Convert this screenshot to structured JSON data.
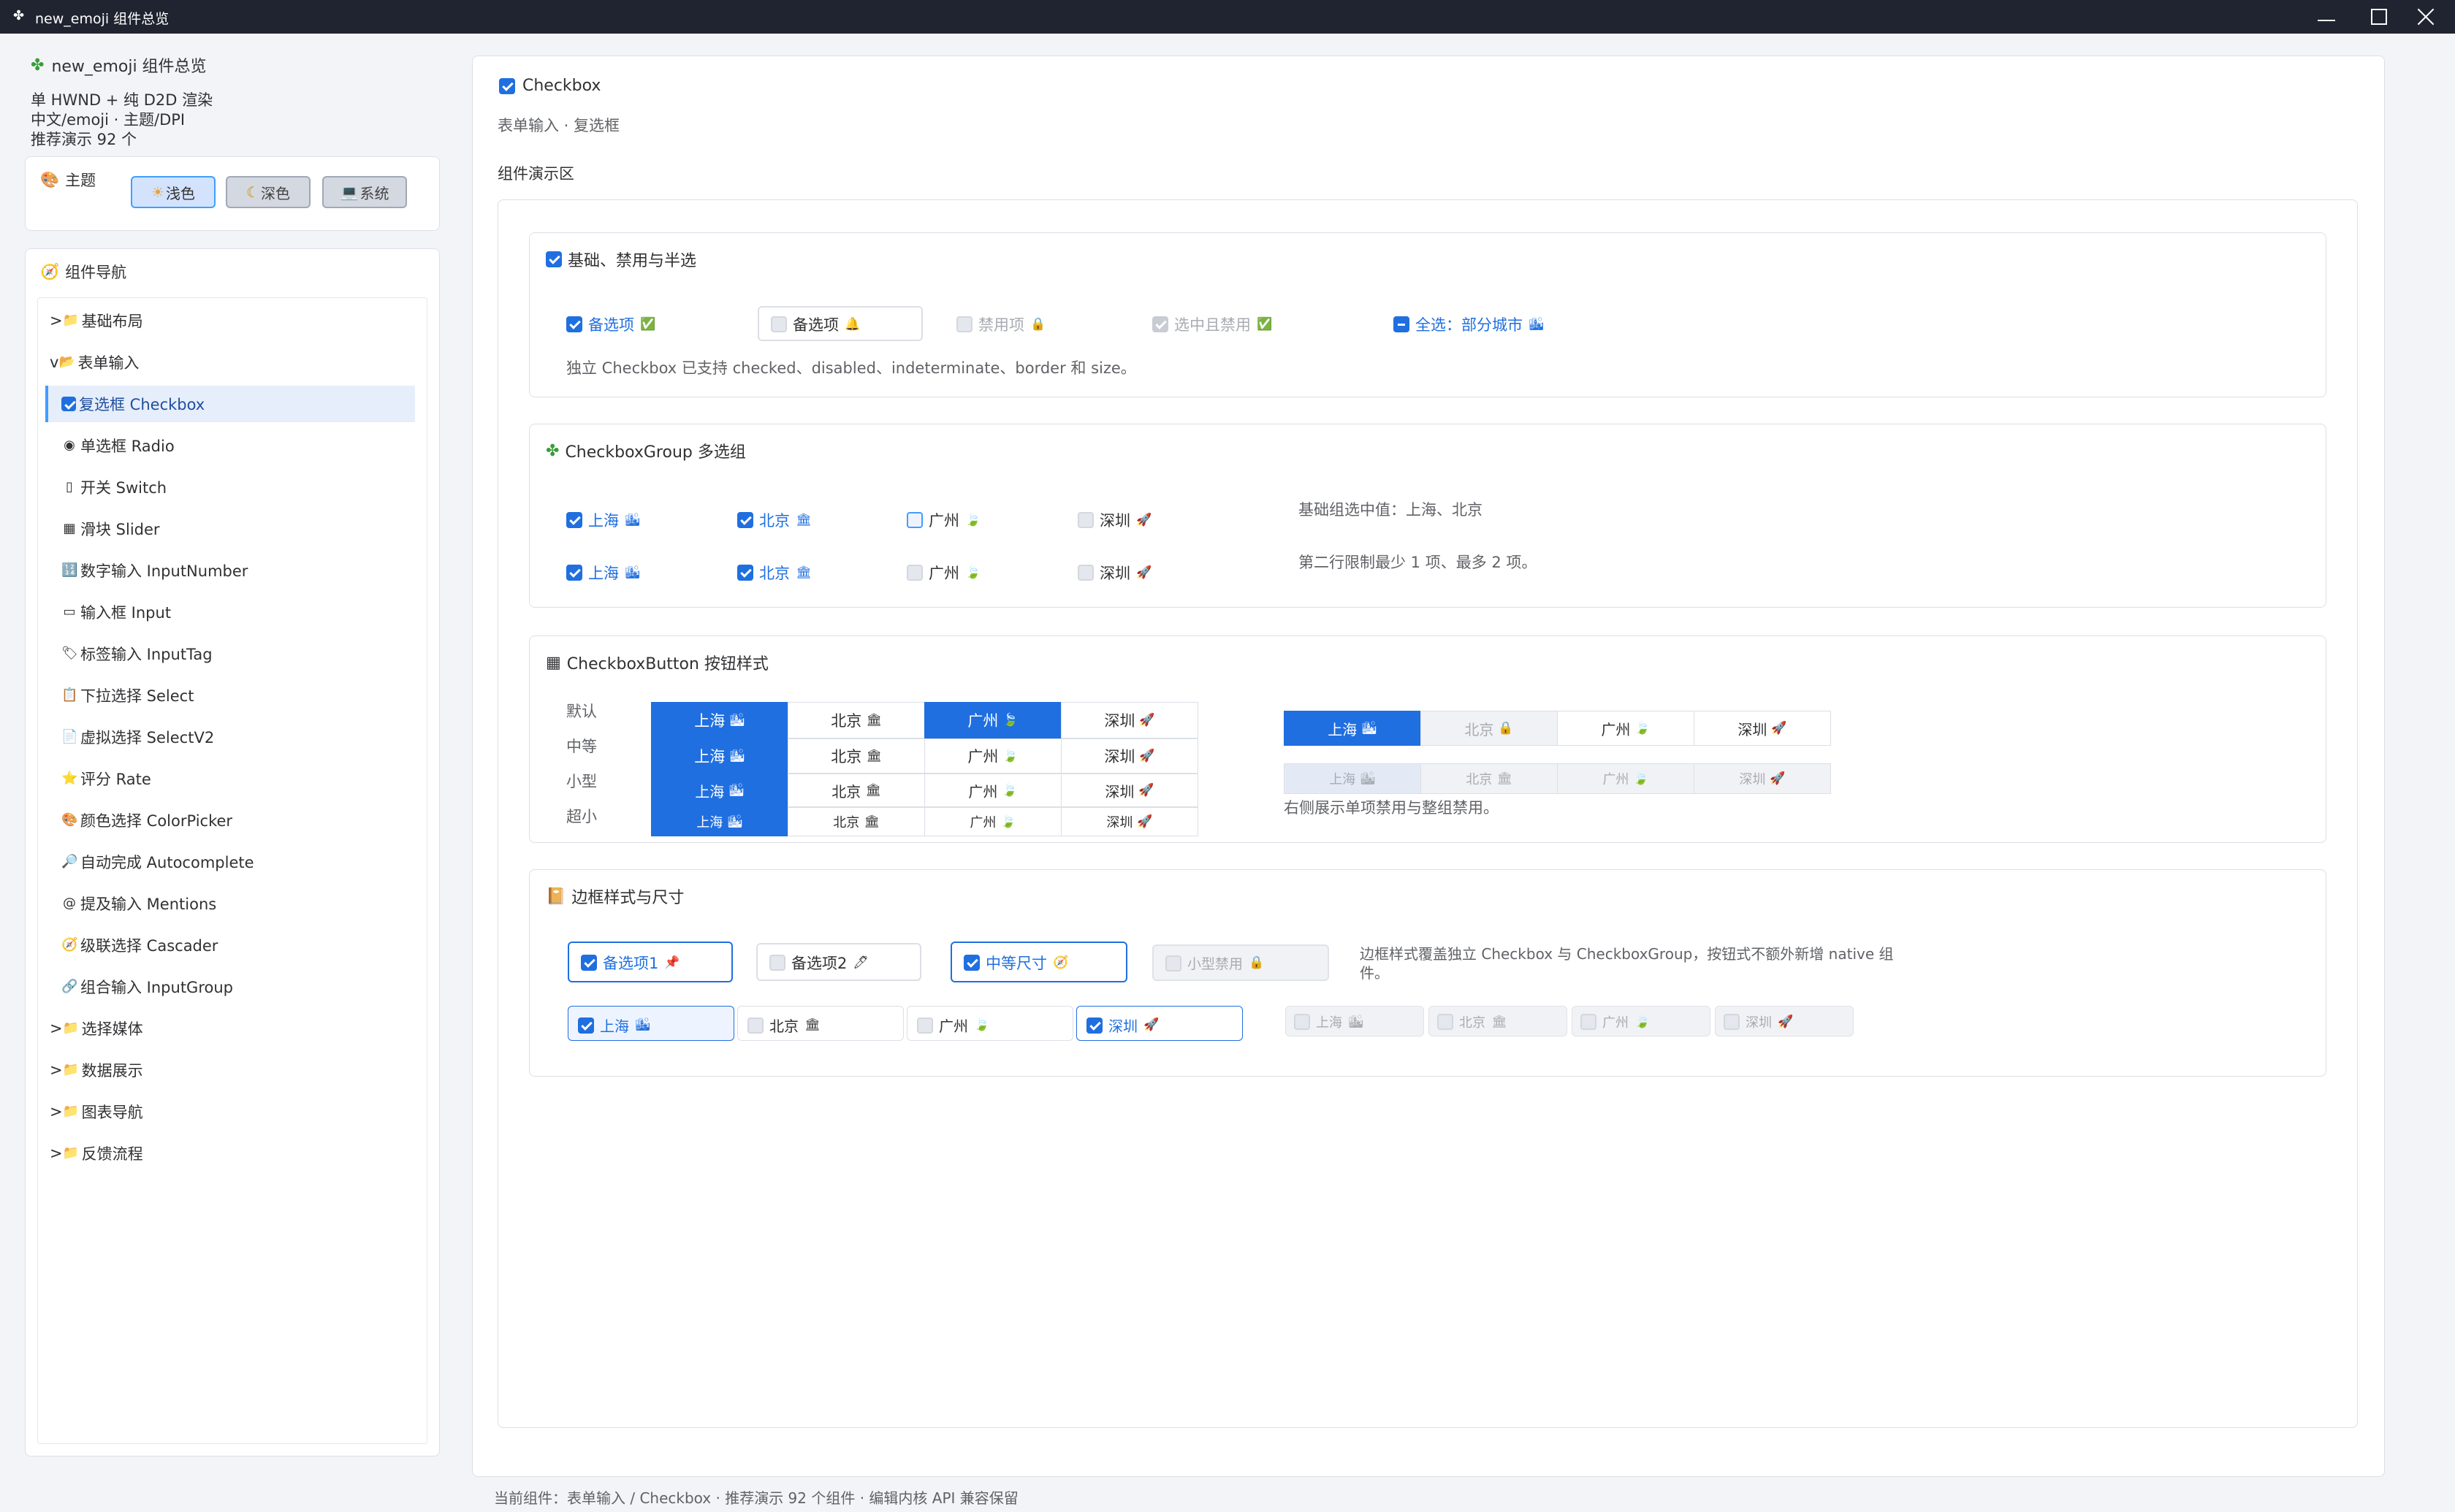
{
  "window": {
    "title": "new_emoji 组件总览",
    "icon": "clover-icon"
  },
  "sidebar": {
    "app_title": "new_emoji 组件总览",
    "info_lines": [
      "单 HWND + 纯 D2D 渲染",
      "中文/emoji · 主题/DPI",
      "推荐演示 92 个"
    ],
    "theme": {
      "label": "主题",
      "buttons": [
        {
          "label": "浅色",
          "icon": "☀",
          "active": true
        },
        {
          "label": "深色",
          "icon": "☾",
          "active": false
        },
        {
          "label": "系统",
          "icon": "💻",
          "active": false
        }
      ]
    },
    "nav": {
      "title": "组件导航",
      "items": [
        {
          "label": "基础布局",
          "prefix": ">",
          "icon": "📁"
        },
        {
          "label": "表单输入",
          "prefix": "v",
          "icon": "📂"
        },
        {
          "label": "复选框 Checkbox",
          "icon": "☑"
        },
        {
          "label": "单选框 Radio",
          "icon": "◉"
        },
        {
          "label": "开关 Switch",
          "icon": "▯"
        },
        {
          "label": "滑块 Slider",
          "icon": "▦"
        },
        {
          "label": "数字输入 InputNumber",
          "icon": "🔢"
        },
        {
          "label": "输入框 Input",
          "icon": "▭"
        },
        {
          "label": "标签输入 InputTag",
          "icon": "🏷"
        },
        {
          "label": "下拉选择 Select",
          "icon": "📋"
        },
        {
          "label": "虚拟选择 SelectV2",
          "icon": "📄"
        },
        {
          "label": "评分 Rate",
          "icon": "⭐"
        },
        {
          "label": "颜色选择 ColorPicker",
          "icon": "🎨"
        },
        {
          "label": "自动完成 Autocomplete",
          "icon": "🔎"
        },
        {
          "label": "提及输入 Mentions",
          "icon": "@"
        },
        {
          "label": "级联选择 Cascader",
          "icon": "🧭"
        },
        {
          "label": "组合输入 InputGroup",
          "icon": "🔗"
        },
        {
          "label": "选择媒体",
          "prefix": ">",
          "icon": "📁"
        },
        {
          "label": "数据展示",
          "prefix": ">",
          "icon": "📁"
        },
        {
          "label": "图表导航",
          "prefix": ">",
          "icon": "📁"
        },
        {
          "label": "反馈流程",
          "prefix": ">",
          "icon": "📁"
        }
      ]
    }
  },
  "main": {
    "title": "Checkbox",
    "subtitle": "表单输入 · 复选框",
    "demo_label": "组件演示区",
    "sec1": {
      "title": "基础、禁用与半选",
      "items": [
        {
          "label": "备选项",
          "emoji": "✅",
          "state": "on"
        },
        {
          "label": "备选项",
          "emoji": "🔔",
          "state": "off"
        },
        {
          "label": "禁用项",
          "emoji": "🔒",
          "state": "dis"
        },
        {
          "label": "选中且禁用",
          "emoji": "✅",
          "state": "dison"
        },
        {
          "label": "全选：部分城市",
          "emoji": "🏙",
          "state": "ind"
        }
      ],
      "note": "独立 Checkbox 已支持 checked、disabled、indeterminate、border 和 size。"
    },
    "sec2": {
      "title": "CheckboxGroup 多选组",
      "row1": [
        {
          "label": "上海",
          "emoji": "🏙",
          "state": "on"
        },
        {
          "label": "北京",
          "emoji": "🏛",
          "state": "on"
        },
        {
          "label": "广州",
          "emoji": "🍃",
          "state": "hl"
        },
        {
          "label": "深圳",
          "emoji": "🚀",
          "state": "dis"
        }
      ],
      "row2": [
        {
          "label": "上海",
          "emoji": "🏙",
          "state": "on"
        },
        {
          "label": "北京",
          "emoji": "🏛",
          "state": "on"
        },
        {
          "label": "广州",
          "emoji": "🍃",
          "state": "dis"
        },
        {
          "label": "深圳",
          "emoji": "🚀",
          "state": "dis"
        }
      ],
      "note1": "基础组选中值：上海、北京",
      "note2": "第二行限制最少 1 项、最多 2 项。"
    },
    "sec3": {
      "title": "CheckboxButton 按钮样式",
      "size_labels": [
        "默认",
        "中等",
        "小型",
        "超小"
      ],
      "rows": [
        [
          {
            "label": "上海",
            "emoji": "🏙",
            "state": "on"
          },
          {
            "label": "北京",
            "emoji": "🏛",
            "state": "off"
          },
          {
            "label": "广州",
            "emoji": "🍃",
            "state": "on"
          },
          {
            "label": "深圳",
            "emoji": "🚀",
            "state": "off"
          }
        ],
        [
          {
            "label": "上海",
            "emoji": "🏙",
            "state": "on"
          },
          {
            "label": "北京",
            "emoji": "🏛",
            "state": "off"
          },
          {
            "label": "广州",
            "emoji": "🍃",
            "state": "off"
          },
          {
            "label": "深圳",
            "emoji": "🚀",
            "state": "off"
          }
        ],
        [
          {
            "label": "上海",
            "emoji": "🏙",
            "state": "on"
          },
          {
            "label": "北京",
            "emoji": "🏛",
            "state": "off"
          },
          {
            "label": "广州",
            "emoji": "🍃",
            "state": "off"
          },
          {
            "label": "深圳",
            "emoji": "🚀",
            "state": "off"
          }
        ],
        [
          {
            "label": "上海",
            "emoji": "🏙",
            "state": "on"
          },
          {
            "label": "北京",
            "emoji": "🏛",
            "state": "off"
          },
          {
            "label": "广州",
            "emoji": "🍃",
            "state": "off"
          },
          {
            "label": "深圳",
            "emoji": "🚀",
            "state": "off"
          }
        ]
      ],
      "right_row1": [
        {
          "label": "上海",
          "emoji": "🏙",
          "state": "on"
        },
        {
          "label": "北京",
          "emoji": "🔒",
          "state": "dis"
        },
        {
          "label": "广州",
          "emoji": "🍃",
          "state": "off"
        },
        {
          "label": "深圳",
          "emoji": "🚀",
          "state": "off"
        }
      ],
      "right_row2": [
        {
          "label": "上海",
          "emoji": "🏙",
          "state": "dison"
        },
        {
          "label": "北京",
          "emoji": "🏛",
          "state": "dis"
        },
        {
          "label": "广州",
          "emoji": "🍃",
          "state": "dis"
        },
        {
          "label": "深圳",
          "emoji": "🚀",
          "state": "dis"
        }
      ],
      "note": "右侧展示单项禁用与整组禁用。"
    },
    "sec4": {
      "title": "边框样式与尺寸",
      "row1": [
        {
          "label": "备选项1",
          "emoji": "📌",
          "state": "on"
        },
        {
          "label": "备选项2",
          "emoji": "🖊",
          "state": "off"
        },
        {
          "label": "中等尺寸",
          "emoji": "🧭",
          "state": "on"
        },
        {
          "label": "小型禁用",
          "emoji": "🔒",
          "state": "dis"
        }
      ],
      "row2": [
        {
          "label": "上海",
          "emoji": "🏙",
          "state": "on"
        },
        {
          "label": "北京",
          "emoji": "🏛",
          "state": "off"
        },
        {
          "label": "广州",
          "emoji": "🍃",
          "state": "off"
        },
        {
          "label": "深圳",
          "emoji": "🚀",
          "state": "on"
        }
      ],
      "row2_dis": [
        {
          "label": "上海",
          "emoji": "🏙"
        },
        {
          "label": "北京",
          "emoji": "🏛"
        },
        {
          "label": "广州",
          "emoji": "🍃"
        },
        {
          "label": "深圳",
          "emoji": "🚀"
        }
      ],
      "note_line1": "边框样式覆盖独立 Checkbox 与 CheckboxGroup，按钮式不额外新增 native 组",
      "note_line2": "件。"
    }
  },
  "statusbar": {
    "text": "当前组件：表单输入 / Checkbox · 推荐演示 92 个组件 · 编辑内核 API 兼容保留"
  },
  "colors": {
    "accent": "#1f6fe0",
    "titlebar": "#1f2430",
    "background": "#f2f4f7"
  }
}
